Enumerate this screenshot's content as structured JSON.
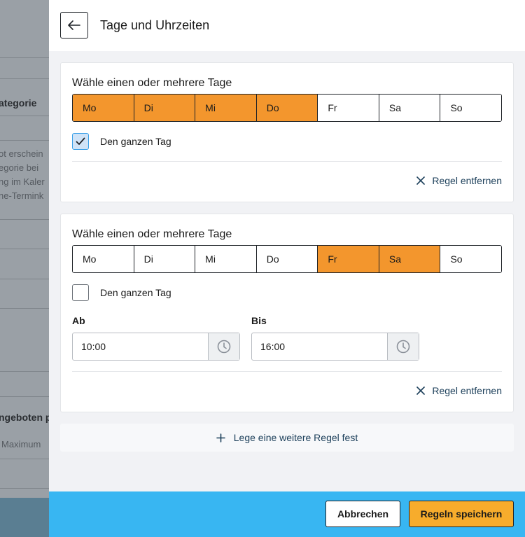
{
  "background": {
    "texts": [
      "ategorie",
      "ot erschein",
      "egorie bei",
      "ng im Kaler",
      "ne-Termink",
      "ngeboten p",
      "Maximum"
    ]
  },
  "panel": {
    "title": "Tage und Uhrzeiten",
    "back_icon": "arrow-left-icon"
  },
  "rules": [
    {
      "heading": "Wähle einen oder mehrere Tage",
      "days": [
        {
          "label": "Mo",
          "selected": true
        },
        {
          "label": "Di",
          "selected": true
        },
        {
          "label": "Mi",
          "selected": true
        },
        {
          "label": "Do",
          "selected": true
        },
        {
          "label": "Fr",
          "selected": false
        },
        {
          "label": "Sa",
          "selected": false
        },
        {
          "label": "So",
          "selected": false
        }
      ],
      "all_day_label": "Den ganzen Tag",
      "all_day_checked": true,
      "remove_label": "Regel entfernen"
    },
    {
      "heading": "Wähle einen oder mehrere Tage",
      "days": [
        {
          "label": "Mo",
          "selected": false
        },
        {
          "label": "Di",
          "selected": false
        },
        {
          "label": "Mi",
          "selected": false
        },
        {
          "label": "Do",
          "selected": false
        },
        {
          "label": "Fr",
          "selected": true
        },
        {
          "label": "Sa",
          "selected": true
        },
        {
          "label": "So",
          "selected": false
        }
      ],
      "all_day_label": "Den ganzen Tag",
      "all_day_checked": false,
      "from_label": "Ab",
      "from_value": "10:00",
      "to_label": "Bis",
      "to_value": "16:00",
      "remove_label": "Regel entfernen"
    }
  ],
  "add_rule_label": "Lege eine weitere Regel fest",
  "footer": {
    "cancel_label": "Abbrechen",
    "save_label": "Regeln speichern"
  },
  "colors": {
    "selected_day": "#f3962d",
    "footer_bg": "#38b6f2",
    "save_button": "#f7ac2c",
    "link": "#1c3f5a"
  }
}
